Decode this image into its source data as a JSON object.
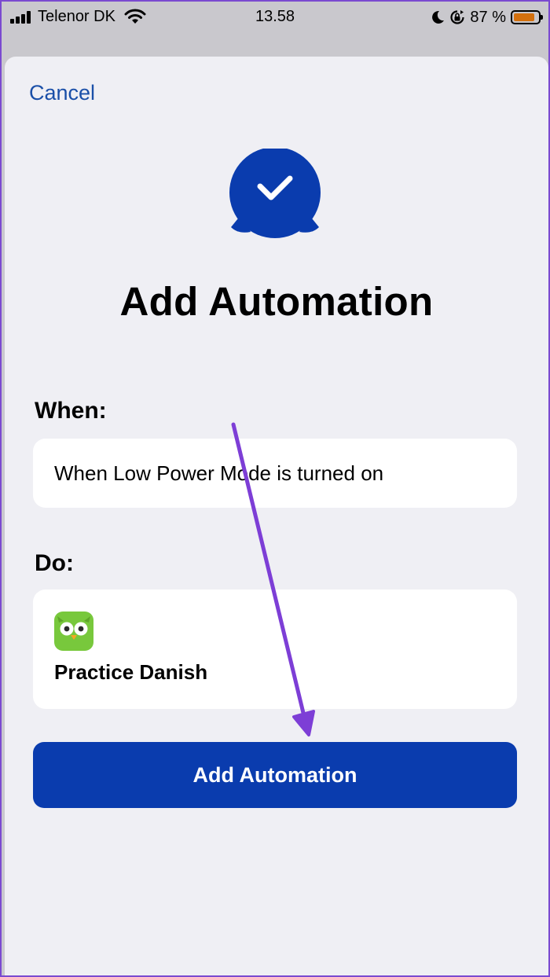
{
  "status_bar": {
    "carrier": "Telenor DK",
    "time": "13.58",
    "battery_text": "87 %",
    "battery_level": 0.87,
    "icons": [
      "signal-bars-icon",
      "wifi-icon",
      "moon-icon",
      "rotation-lock-icon",
      "battery-icon"
    ]
  },
  "sheet": {
    "cancel_label": "Cancel",
    "header_icon": "automation-check-icon",
    "title": "Add Automation",
    "when": {
      "label": "When:",
      "value": "When Low Power Mode is turned on"
    },
    "do": {
      "label": "Do:",
      "app_icon": "duolingo-owl-icon",
      "action": "Practice Danish"
    },
    "add_button_label": "Add Automation"
  },
  "annotation": {
    "icon": "arrow-annotation-icon",
    "color": "#7d3ed6"
  },
  "colors": {
    "accent": "#0a3cae",
    "link": "#1a4fa8",
    "sheet_bg": "#efeff4",
    "battery": "#d3700e"
  }
}
